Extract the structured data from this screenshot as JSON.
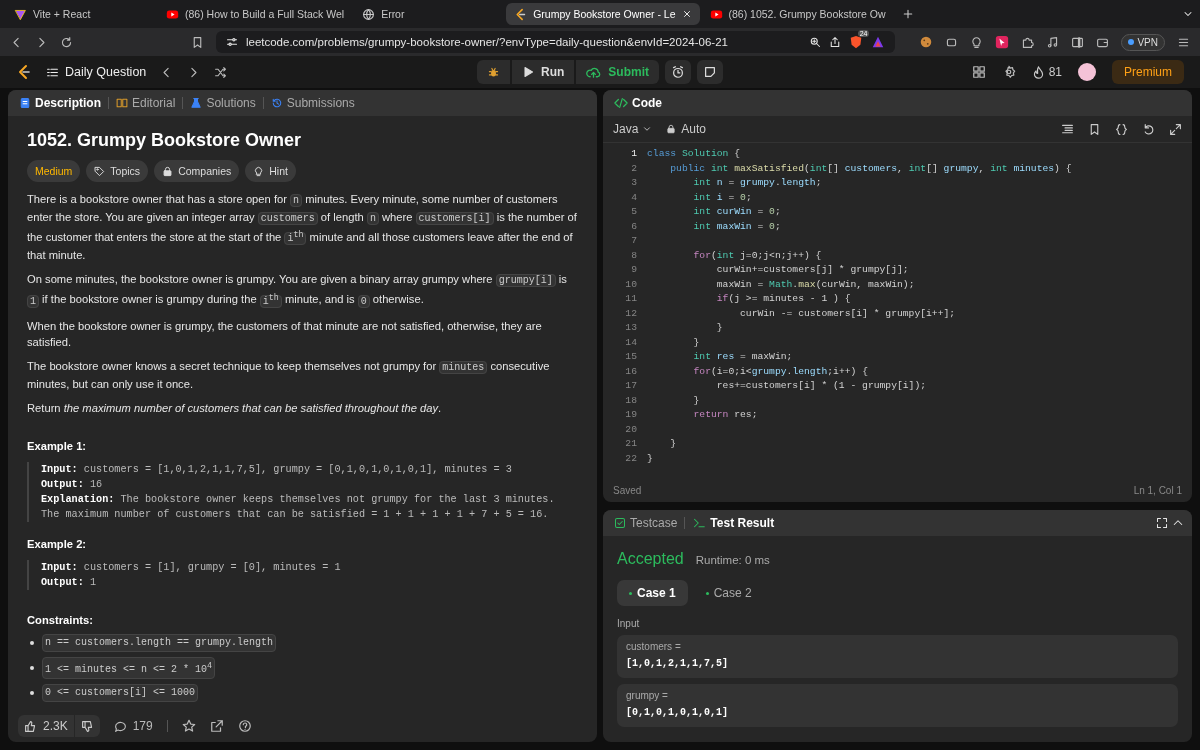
{
  "browser": {
    "tabs": [
      {
        "kind": "vite",
        "title": "Vite + React",
        "selected": false
      },
      {
        "kind": "youtube",
        "title": "(86) How to Build a Full Stack Wel",
        "selected": false
      },
      {
        "kind": "globe",
        "title": "Error",
        "selected": false
      },
      {
        "kind": "leetcode",
        "title": "Grumpy Bookstore Owner - Le",
        "selected": true
      },
      {
        "kind": "youtube",
        "title": "(86) 1052. Grumpy Bookstore Ow",
        "selected": false
      }
    ],
    "address": "leetcode.com/problems/grumpy-bookstore-owner/?envType=daily-question&envId=2024-06-21",
    "shield_badge": "24",
    "vpn": "VPN"
  },
  "toolbar": {
    "title": "Daily Question",
    "run": "Run",
    "submit": "Submit",
    "streak": "81",
    "premium": "Premium"
  },
  "description_panel": {
    "tabs": [
      {
        "label": "Description",
        "selected": true
      },
      {
        "label": "Editorial",
        "selected": false
      },
      {
        "label": "Solutions",
        "selected": false
      },
      {
        "label": "Submissions",
        "selected": false
      }
    ],
    "title": "1052. Grumpy Bookstore Owner",
    "tags": [
      {
        "kind": "difficulty",
        "label": "Medium"
      },
      {
        "kind": "topics",
        "label": "Topics"
      },
      {
        "kind": "companies",
        "label": "Companies"
      },
      {
        "kind": "hint",
        "label": "Hint"
      }
    ],
    "paragraphs": [
      [
        {
          "kind": "text",
          "text": "There is a bookstore owner that has a store open for "
        },
        {
          "kind": "code",
          "text": "n"
        },
        {
          "kind": "text",
          "text": " minutes. Every minute, some number of customers enter the store. You are given an integer array "
        },
        {
          "kind": "code",
          "text": "customers"
        },
        {
          "kind": "text",
          "text": " of length "
        },
        {
          "kind": "code",
          "text": "n"
        },
        {
          "kind": "text",
          "text": " where "
        },
        {
          "kind": "code",
          "text": "customers[i]"
        },
        {
          "kind": "text",
          "text": " is the number of the customer that enters the store at the start of the "
        },
        {
          "kind": "code",
          "text": "i$^{th}$"
        },
        {
          "kind": "text",
          "text": " minute and all those customers leave after the end of that minute."
        }
      ],
      [
        {
          "kind": "text",
          "text": "On some minutes, the bookstore owner is grumpy. You are given a binary array grumpy where "
        },
        {
          "kind": "code",
          "text": "grumpy[i]"
        },
        {
          "kind": "text",
          "text": " is "
        },
        {
          "kind": "code",
          "text": "1"
        },
        {
          "kind": "text",
          "text": " if the bookstore owner is grumpy during the "
        },
        {
          "kind": "code",
          "text": "i$^{th}$"
        },
        {
          "kind": "text",
          "text": " minute, and is "
        },
        {
          "kind": "code",
          "text": "0"
        },
        {
          "kind": "text",
          "text": " otherwise."
        }
      ],
      [
        {
          "kind": "text",
          "text": "When the bookstore owner is grumpy, the customers of that minute are not satisfied, otherwise, they are satisfied."
        }
      ],
      [
        {
          "kind": "text",
          "text": "The bookstore owner knows a secret technique to keep themselves not grumpy for "
        },
        {
          "kind": "code",
          "text": "minutes"
        },
        {
          "kind": "text",
          "text": " consecutive minutes, but can only use it once."
        }
      ],
      [
        {
          "kind": "text",
          "text": "Return *the maximum number of customers that can be satisfied throughout the day*."
        }
      ]
    ],
    "examples": [
      {
        "heading": "Example 1:",
        "lines": [
          "**Input:** customers = [1,0,1,2,1,1,7,5], grumpy = [0,1,0,1,0,1,0,1], minutes = 3",
          "**Output:** 16",
          "**Explanation:** The bookstore owner keeps themselves not grumpy for the last 3 minutes.",
          "The maximum number of customers that can be satisfied = 1 + 1 + 1 + 1 + 7 + 5 = 16."
        ]
      },
      {
        "heading": "Example 2:",
        "lines": [
          "**Input:** customers = [1], grumpy = [0], minutes = 1",
          "**Output:** 1"
        ]
      }
    ],
    "constraints_heading": "Constraints:",
    "constraints": [
      "n == customers.length == grumpy.length",
      "1 <= minutes <= n <= 2 * 10$^{4}$",
      "0 <= customers[i] <= 1000"
    ],
    "likes": "2.3K",
    "comments": "179"
  },
  "code_panel": {
    "title": "Code",
    "language": "Java",
    "mode": "Auto",
    "lines": [
      {
        "number": "1",
        "tokens": [
          {
            "text": "class ",
            "kind": "kw"
          },
          {
            "text": "Solution",
            "kind": "type"
          },
          {
            "text": " {",
            "kind": "plain"
          }
        ]
      },
      {
        "number": "2",
        "tokens": [
          {
            "text": "    public ",
            "kind": "kw"
          },
          {
            "text": "int ",
            "kind": "type"
          },
          {
            "text": "maxSatisfied",
            "kind": "fn"
          },
          {
            "text": "(",
            "kind": "plain"
          },
          {
            "text": "int",
            "kind": "type"
          },
          {
            "text": "[] ",
            "kind": "plain"
          },
          {
            "text": "customers",
            "kind": "var"
          },
          {
            "text": ", ",
            "kind": "plain"
          },
          {
            "text": "int",
            "kind": "type"
          },
          {
            "text": "[] ",
            "kind": "plain"
          },
          {
            "text": "grumpy",
            "kind": "var"
          },
          {
            "text": ", ",
            "kind": "plain"
          },
          {
            "text": "int ",
            "kind": "type"
          },
          {
            "text": "minutes",
            "kind": "var"
          },
          {
            "text": ") {",
            "kind": "plain"
          }
        ]
      },
      {
        "number": "3",
        "tokens": [
          {
            "text": "        int ",
            "kind": "type"
          },
          {
            "text": "n",
            "kind": "var"
          },
          {
            "text": " = ",
            "kind": "plain"
          },
          {
            "text": "grumpy",
            "kind": "var"
          },
          {
            "text": ".",
            "kind": "plain"
          },
          {
            "text": "length",
            "kind": "var"
          },
          {
            "text": ";",
            "kind": "plain"
          }
        ]
      },
      {
        "number": "4",
        "tokens": [
          {
            "text": "        int ",
            "kind": "type"
          },
          {
            "text": "i",
            "kind": "var"
          },
          {
            "text": " = ",
            "kind": "plain"
          },
          {
            "text": "0",
            "kind": "num"
          },
          {
            "text": ";",
            "kind": "plain"
          }
        ]
      },
      {
        "number": "5",
        "tokens": [
          {
            "text": "        int ",
            "kind": "type"
          },
          {
            "text": "curWin",
            "kind": "var"
          },
          {
            "text": " = ",
            "kind": "plain"
          },
          {
            "text": "0",
            "kind": "num"
          },
          {
            "text": ";",
            "kind": "plain"
          }
        ]
      },
      {
        "number": "6",
        "tokens": [
          {
            "text": "        int ",
            "kind": "type"
          },
          {
            "text": "maxWin",
            "kind": "var"
          },
          {
            "text": " = ",
            "kind": "plain"
          },
          {
            "text": "0",
            "kind": "num"
          },
          {
            "text": ";",
            "kind": "plain"
          }
        ]
      },
      {
        "number": "7"
      },
      {
        "number": "8",
        "tokens": [
          {
            "text": "        for",
            "kind": "ctrl"
          },
          {
            "text": "(",
            "kind": "plain"
          },
          {
            "text": "int ",
            "kind": "type"
          },
          {
            "text": "j=0;j<n;j++) {",
            "kind": "plain"
          }
        ]
      },
      {
        "number": "9",
        "tokens": [
          {
            "text": "            curWin+=customers[j] * grumpy[j];",
            "kind": "plain"
          }
        ]
      },
      {
        "number": "10",
        "tokens": [
          {
            "text": "            maxWin = ",
            "kind": "plain"
          },
          {
            "text": "Math",
            "kind": "type"
          },
          {
            "text": ".",
            "kind": "plain"
          },
          {
            "text": "max",
            "kind": "fn"
          },
          {
            "text": "(curWin, maxWin);",
            "kind": "plain"
          }
        ]
      },
      {
        "number": "11",
        "tokens": [
          {
            "text": "            if",
            "kind": "ctrl"
          },
          {
            "text": "(j >= minutes - 1 ) {",
            "kind": "plain"
          }
        ]
      },
      {
        "number": "12",
        "tokens": [
          {
            "text": "                curWin -= customers[i] * grumpy[i++];",
            "kind": "plain"
          }
        ]
      },
      {
        "number": "13",
        "tokens": [
          {
            "text": "            }",
            "kind": "plain"
          }
        ]
      },
      {
        "number": "14",
        "tokens": [
          {
            "text": "        }",
            "kind": "plain"
          }
        ]
      },
      {
        "number": "15",
        "tokens": [
          {
            "text": "        int ",
            "kind": "type"
          },
          {
            "text": "res",
            "kind": "var"
          },
          {
            "text": " = maxWin;",
            "kind": "plain"
          }
        ]
      },
      {
        "number": "16",
        "tokens": [
          {
            "text": "        for",
            "kind": "ctrl"
          },
          {
            "text": "(i=0;i<",
            "kind": "plain"
          },
          {
            "text": "grumpy",
            "kind": "var"
          },
          {
            "text": ".",
            "kind": "plain"
          },
          {
            "text": "length",
            "kind": "var"
          },
          {
            "text": ";i++) {",
            "kind": "plain"
          }
        ]
      },
      {
        "number": "17",
        "tokens": [
          {
            "text": "            res+=customers[i] * (1 - grumpy[i]);",
            "kind": "plain"
          }
        ]
      },
      {
        "number": "18",
        "tokens": [
          {
            "text": "        }",
            "kind": "plain"
          }
        ]
      },
      {
        "number": "19",
        "tokens": [
          {
            "text": "        return ",
            "kind": "ctrl"
          },
          {
            "text": "res;",
            "kind": "plain"
          }
        ]
      },
      {
        "number": "20"
      },
      {
        "number": "21",
        "tokens": [
          {
            "text": "    }",
            "kind": "plain"
          }
        ]
      },
      {
        "number": "22",
        "tokens": [
          {
            "text": "}",
            "kind": "plain"
          }
        ]
      }
    ],
    "status": "Saved",
    "cursor": "Ln 1, Col 1"
  },
  "result_panel": {
    "tabs": [
      {
        "label": "Testcase",
        "selected": false
      },
      {
        "label": "Test Result",
        "selected": true
      }
    ],
    "verdict": "Accepted",
    "runtime": "Runtime: 0 ms",
    "cases": [
      {
        "label": "Case 1",
        "selected": true
      },
      {
        "label": "Case 2",
        "selected": false
      }
    ],
    "input_label": "Input",
    "inputs": [
      {
        "name": "customers =",
        "value": "[1,0,1,2,1,1,7,5]"
      },
      {
        "name": "grumpy =",
        "value": "[0,1,0,1,0,1,0,1]"
      }
    ]
  }
}
